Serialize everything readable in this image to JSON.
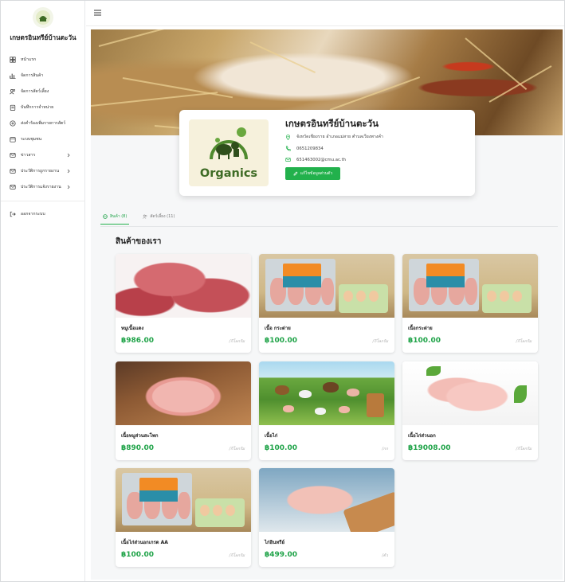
{
  "sidebar": {
    "brand": "เกษตรอินทรีย์บ้านตะวัน",
    "items": [
      {
        "label": "หน้าแรก",
        "icon": "dashboard-icon"
      },
      {
        "label": "จัดการสินค้า",
        "icon": "chart-icon"
      },
      {
        "label": "จัดการสัตว์เลี้ยง",
        "icon": "users-icon"
      },
      {
        "label": "บันทึกการจำหน่าย",
        "icon": "clipboard-icon"
      },
      {
        "label": "ส่งคำร้องเพิ่มรายการสัตว์",
        "icon": "plus-circle-icon"
      },
      {
        "label": "ระบบชุมชน",
        "icon": "calendar-icon"
      },
      {
        "label": "ข่าวสาร",
        "icon": "mail-icon"
      },
      {
        "label": "ประวัติการถูกรายงาน",
        "icon": "mail-icon"
      },
      {
        "label": "ประวัติการแจ้งรายงาน",
        "icon": "mail-icon"
      }
    ],
    "logout": "ออกจากระบบ"
  },
  "profile": {
    "logo_word": "Organics",
    "name": "เกษตรอินทรีย์บ้านตะวัน",
    "address": "จังหวัดเชียงราย อำเภอแม่สาย ตำบลเวียงพางคำ",
    "phone": "0651209834",
    "email": "651463002@cmu.ac.th",
    "edit_label": "แก้ไขข้อมูลส่วนตัว"
  },
  "tabs": [
    {
      "label": "สินค้า (8)",
      "active": true
    },
    {
      "label": "สัตว์เลี้ยง (11)",
      "active": false
    }
  ],
  "section_title": "สินค้าของเรา",
  "products": [
    {
      "name": "หมูเนื้อแดง",
      "price": "฿986.00",
      "unit": "/กิโลกรัม"
    },
    {
      "name": "เนื้อ กระต่าย",
      "price": "฿100.00",
      "unit": "/กิโลกรัม"
    },
    {
      "name": "เนื้อกระต่าย",
      "price": "฿100.00",
      "unit": "/กิโลกรัม"
    },
    {
      "name": "เนื้อหมูส่วนสะโพก",
      "price": "฿890.00",
      "unit": "/กิโลกรัม"
    },
    {
      "name": "เนื้อไก่",
      "price": "฿100.00",
      "unit": "/กก"
    },
    {
      "name": "เนื้อไก่ส่วนอก",
      "price": "฿19008.00",
      "unit": "/กิโลกรัม"
    },
    {
      "name": "เนื้อไก่ส่วนอกเกรด AA",
      "price": "฿100.00",
      "unit": "/กิโลกรัม"
    },
    {
      "name": "ไก่อินทรีย์",
      "price": "฿499.00",
      "unit": "/ตัว"
    }
  ],
  "colors": {
    "accent": "#22b14c",
    "price": "#1fa348"
  }
}
